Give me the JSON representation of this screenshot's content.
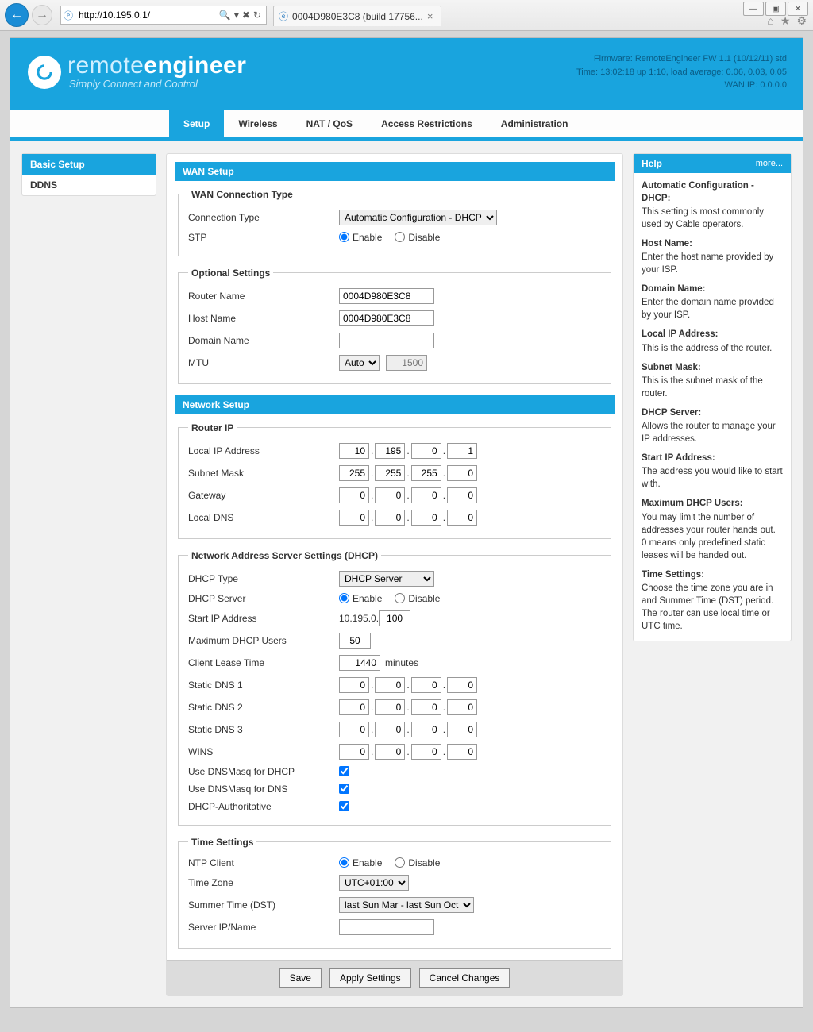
{
  "browser": {
    "url": "http://10.195.0.1/",
    "search_glyph": "🔍",
    "tab_title": "0004D980E3C8 (build 17756...",
    "win_min": "—",
    "win_max": "▣",
    "win_close": "✕",
    "icon_home": "⌂",
    "icon_star": "★",
    "icon_gear": "⚙"
  },
  "hero": {
    "brand_light": "remote",
    "brand_bold": "engineer",
    "tagline": "Simply Connect and Control",
    "fw": "Firmware: RemoteEngineer FW 1.1 (10/12/11) std",
    "time": "Time: 13:02:18 up 1:10, load average: 0.06, 0.03, 0.05",
    "wan": "WAN IP: 0.0.0.0"
  },
  "nav": {
    "setup": "Setup",
    "wireless": "Wireless",
    "natqos": "NAT / QoS",
    "access": "Access Restrictions",
    "admin": "Administration"
  },
  "leftnav": {
    "basic": "Basic Setup",
    "ddns": "DDNS"
  },
  "wan": {
    "section": "WAN Setup",
    "fs_conn": "WAN Connection Type",
    "conn_label": "Connection Type",
    "conn_value": "Automatic Configuration - DHCP",
    "stp_label": "STP",
    "enable": "Enable",
    "disable": "Disable",
    "fs_opt": "Optional Settings",
    "router_label": "Router Name",
    "router_val": "0004D980E3C8",
    "host_label": "Host Name",
    "host_val": "0004D980E3C8",
    "domain_label": "Domain Name",
    "domain_val": "",
    "mtu_label": "MTU",
    "mtu_mode": "Auto",
    "mtu_val": "1500"
  },
  "net": {
    "section": "Network Setup",
    "fs_router": "Router IP",
    "lip_label": "Local IP Address",
    "lip": [
      "10",
      "195",
      "0",
      "1"
    ],
    "mask_label": "Subnet Mask",
    "mask": [
      "255",
      "255",
      "255",
      "0"
    ],
    "gw_label": "Gateway",
    "gw": [
      "0",
      "0",
      "0",
      "0"
    ],
    "ldns_label": "Local DNS",
    "ldns": [
      "0",
      "0",
      "0",
      "0"
    ],
    "fs_dhcp": "Network Address Server Settings (DHCP)",
    "dhcp_type_label": "DHCP Type",
    "dhcp_type": "DHCP Server",
    "dhcp_srv_label": "DHCP Server",
    "start_label": "Start IP Address",
    "start_prefix": "10.195.0.",
    "start_val": "100",
    "max_label": "Maximum DHCP Users",
    "max_val": "50",
    "lease_label": "Client Lease Time",
    "lease_val": "1440",
    "lease_unit": "minutes",
    "sdns1_label": "Static DNS 1",
    "sdns1": [
      "0",
      "0",
      "0",
      "0"
    ],
    "sdns2_label": "Static DNS 2",
    "sdns2": [
      "0",
      "0",
      "0",
      "0"
    ],
    "sdns3_label": "Static DNS 3",
    "sdns3": [
      "0",
      "0",
      "0",
      "0"
    ],
    "wins_label": "WINS",
    "wins": [
      "0",
      "0",
      "0",
      "0"
    ],
    "dnsmasq_dhcp": "Use DNSMasq for DHCP",
    "dnsmasq_dns": "Use DNSMasq for DNS",
    "dhcp_auth": "DHCP-Authoritative",
    "fs_time": "Time Settings",
    "ntp_label": "NTP Client",
    "tz_label": "Time Zone",
    "tz_val": "UTC+01:00",
    "dst_label": "Summer Time (DST)",
    "dst_val": "last Sun Mar - last Sun Oct",
    "srv_label": "Server IP/Name",
    "srv_val": ""
  },
  "buttons": {
    "save": "Save",
    "apply": "Apply Settings",
    "cancel": "Cancel Changes"
  },
  "help": {
    "title": "Help",
    "more": "more...",
    "items": [
      {
        "h": "Automatic Configuration - DHCP:",
        "t": "This setting is most commonly used by Cable operators."
      },
      {
        "h": "Host Name:",
        "t": "Enter the host name provided by your ISP."
      },
      {
        "h": "Domain Name:",
        "t": "Enter the domain name provided by your ISP."
      },
      {
        "h": "Local IP Address:",
        "t": "This is the address of the router."
      },
      {
        "h": "Subnet Mask:",
        "t": "This is the subnet mask of the router."
      },
      {
        "h": "DHCP Server:",
        "t": "Allows the router to manage your IP addresses."
      },
      {
        "h": "Start IP Address:",
        "t": "The address you would like to start with."
      },
      {
        "h": "Maximum DHCP Users:",
        "t": "You may limit the number of addresses your router hands out. 0 means only predefined static leases will be handed out."
      },
      {
        "h": "Time Settings:",
        "t": "Choose the time zone you are in and Summer Time (DST) period. The router can use local time or UTC time."
      }
    ]
  }
}
